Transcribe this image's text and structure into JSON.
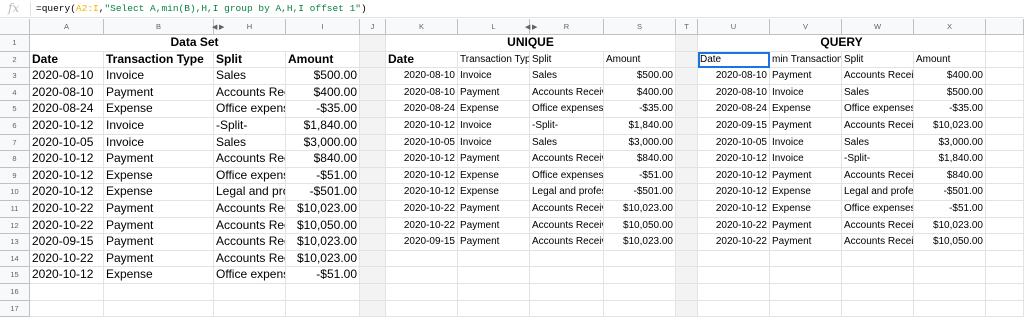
{
  "formula_bar": {
    "fx_label": "fx",
    "formula_prefix": "=query(",
    "formula_range": "A2:I",
    "formula_sep": ",",
    "formula_string": "\"Select A,min(B),H,I group by A,H,I offset 1\"",
    "formula_suffix": ")"
  },
  "columns": [
    "A",
    "B",
    "H",
    "I",
    "J",
    "K",
    "L",
    "R",
    "S",
    "T",
    "U",
    "V",
    "W",
    "X"
  ],
  "rows": [
    "1",
    "2",
    "3",
    "4",
    "5",
    "6",
    "7",
    "8",
    "9",
    "10",
    "11",
    "12",
    "13",
    "14",
    "15",
    "16",
    "17"
  ],
  "dataset": {
    "title": "Data Set",
    "headers": [
      "Date",
      "Transaction Type",
      "Split",
      "Amount"
    ],
    "rows": [
      [
        "2020-08-10",
        "Invoice",
        "Sales",
        "$500.00"
      ],
      [
        "2020-08-10",
        "Payment",
        "Accounts Rec",
        "$400.00"
      ],
      [
        "2020-08-24",
        "Expense",
        "Office expens",
        "-$35.00"
      ],
      [
        "2020-10-12",
        "Invoice",
        "-Split-",
        "$1,840.00"
      ],
      [
        "2020-10-05",
        "Invoice",
        "Sales",
        "$3,000.00"
      ],
      [
        "2020-10-12",
        "Payment",
        "Accounts Rec",
        "$840.00"
      ],
      [
        "2020-10-12",
        "Expense",
        "Office expens",
        "-$51.00"
      ],
      [
        "2020-10-12",
        "Expense",
        "Legal and pro",
        "-$501.00"
      ],
      [
        "2020-10-22",
        "Payment",
        "Accounts Rec",
        "$10,023.00"
      ],
      [
        "2020-10-22",
        "Payment",
        "Accounts Rec",
        "$10,050.00"
      ],
      [
        "2020-09-15",
        "Payment",
        "Accounts Rec",
        "$10,023.00"
      ],
      [
        "2020-10-22",
        "Payment",
        "Accounts Rec",
        "$10,023.00"
      ],
      [
        "2020-10-12",
        "Expense",
        "Office expens",
        "-$51.00"
      ]
    ]
  },
  "unique": {
    "title": "UNIQUE",
    "headers": [
      "Date",
      "Transaction Type",
      "Split",
      "Amount"
    ],
    "rows": [
      [
        "2020-08-10",
        "Invoice",
        "Sales",
        "$500.00"
      ],
      [
        "2020-08-10",
        "Payment",
        "Accounts Receiv",
        "$400.00"
      ],
      [
        "2020-08-24",
        "Expense",
        "Office expenses",
        "-$35.00"
      ],
      [
        "2020-10-12",
        "Invoice",
        "-Split-",
        "$1,840.00"
      ],
      [
        "2020-10-05",
        "Invoice",
        "Sales",
        "$3,000.00"
      ],
      [
        "2020-10-12",
        "Payment",
        "Accounts Receiv",
        "$840.00"
      ],
      [
        "2020-10-12",
        "Expense",
        "Office expenses",
        "-$51.00"
      ],
      [
        "2020-10-12",
        "Expense",
        "Legal and profes",
        "-$501.00"
      ],
      [
        "2020-10-22",
        "Payment",
        "Accounts Receiv",
        "$10,023.00"
      ],
      [
        "2020-10-22",
        "Payment",
        "Accounts Receiv",
        "$10,050.00"
      ],
      [
        "2020-09-15",
        "Payment",
        "Accounts Receiv",
        "$10,023.00"
      ]
    ]
  },
  "query": {
    "title": "QUERY",
    "headers": [
      "Date",
      "min Transaction",
      "Split",
      "Amount"
    ],
    "rows": [
      [
        "2020-08-10",
        "Payment",
        "Accounts Receiv",
        "$400.00"
      ],
      [
        "2020-08-10",
        "Invoice",
        "Sales",
        "$500.00"
      ],
      [
        "2020-08-24",
        "Expense",
        "Office expenses",
        "-$35.00"
      ],
      [
        "2020-09-15",
        "Payment",
        "Accounts Receiv",
        "$10,023.00"
      ],
      [
        "2020-10-05",
        "Invoice",
        "Sales",
        "$3,000.00"
      ],
      [
        "2020-10-12",
        "Invoice",
        "-Split-",
        "$1,840.00"
      ],
      [
        "2020-10-12",
        "Payment",
        "Accounts Receiv",
        "$840.00"
      ],
      [
        "2020-10-12",
        "Expense",
        "Legal and profes",
        "-$501.00"
      ],
      [
        "2020-10-12",
        "Expense",
        "Office expenses",
        "-$51.00"
      ],
      [
        "2020-10-22",
        "Payment",
        "Accounts Receiv",
        "$10,023.00"
      ],
      [
        "2020-10-22",
        "Payment",
        "Accounts Receiv",
        "$10,050.00"
      ]
    ]
  }
}
